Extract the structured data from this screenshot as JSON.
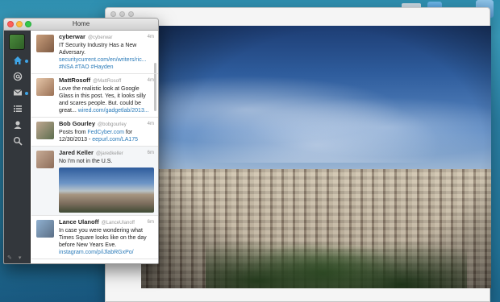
{
  "app": {
    "window_title": "Home"
  },
  "sidebar": {
    "nav": [
      {
        "icon": "home-icon",
        "unread": true
      },
      {
        "icon": "at-mentions-icon",
        "unread": false
      },
      {
        "icon": "envelope-icon",
        "unread": true
      },
      {
        "icon": "list-icon",
        "unread": false
      },
      {
        "icon": "profile-icon",
        "unread": false
      },
      {
        "icon": "search-icon",
        "unread": false
      }
    ],
    "bottom_tools": [
      "compose-icon",
      "chevron-down-icon"
    ]
  },
  "tweets": [
    {
      "name": "cyberwar",
      "handle": "@cyberwar",
      "time": "4m",
      "text": "IT Security Industry Has a New Adversary. ",
      "link": "securitycurrent.com/en/writers/ric... #NSA #TAO #Hayden"
    },
    {
      "name": "MattRosoff",
      "handle": "@MattRosoff",
      "time": "4m",
      "text": "Love the realistic look at Google Glass in this post. Yes, it looks silly and scares people. But. could be great... ",
      "link": "wired.com/gadgetlab/2013..."
    },
    {
      "name": "Bob Gourley",
      "handle": "@bobgourley",
      "time": "4m",
      "text": "Posts from ",
      "link": "FedCyber.com",
      "text2": " for 12/30/2013 - ",
      "link2": "eepurl.com/LA175"
    },
    {
      "name": "Jared Keller",
      "handle": "@jaredkeller",
      "time": "6m",
      "text": "No I'm not in the U.S.",
      "has_media": true
    },
    {
      "name": "Lance Ulanoff",
      "handle": "@LanceUlanoff",
      "time": "6m",
      "text": "In case you were wondering what Times Square looks like on the day before New Years Eve. ",
      "link": "instagram.com/p/iJlabRGxPo/"
    }
  ],
  "colors": {
    "accent": "#2b7bb9",
    "unread_dot": "#3fa4e6",
    "sidebar_bg": "#33373c"
  }
}
